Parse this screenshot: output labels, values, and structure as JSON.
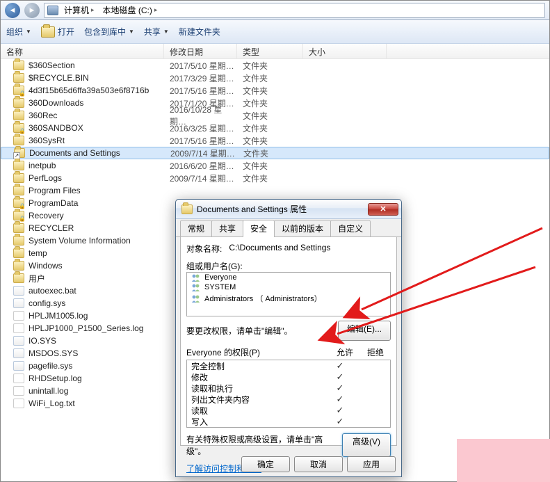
{
  "breadcrumb": {
    "root": "计算机",
    "drive": "本地磁盘 (C:)"
  },
  "toolbar": {
    "organize": "组织",
    "open": "打开",
    "include": "包含到库中",
    "share": "共享",
    "newfolder": "新建文件夹"
  },
  "columns": {
    "name": "名称",
    "date": "修改日期",
    "type": "类型",
    "size": "大小"
  },
  "type_folder": "文件夹",
  "files": [
    {
      "name": "$360Section",
      "date": "2017/5/10 星期…",
      "type": "文件夹",
      "ico": "folder"
    },
    {
      "name": "$RECYCLE.BIN",
      "date": "2017/3/29 星期…",
      "type": "文件夹",
      "ico": "folder"
    },
    {
      "name": "4d3f15b65d6ffa39a503e6f8716b",
      "date": "2017/5/16 星期…",
      "type": "文件夹",
      "ico": "folder lock"
    },
    {
      "name": "360Downloads",
      "date": "2017/1/20 星期…",
      "type": "文件夹",
      "ico": "folder"
    },
    {
      "name": "360Rec",
      "date": "2016/10/28 星期…",
      "type": "文件夹",
      "ico": "folder"
    },
    {
      "name": "360SANDBOX",
      "date": "2016/3/25 星期…",
      "type": "文件夹",
      "ico": "folder lock"
    },
    {
      "name": "360SysRt",
      "date": "2017/5/16 星期…",
      "type": "文件夹",
      "ico": "folder"
    },
    {
      "name": "Documents and Settings",
      "date": "2009/7/14 星期…",
      "type": "文件夹",
      "ico": "folder shortcut",
      "selected": true
    },
    {
      "name": "inetpub",
      "date": "2016/6/20 星期…",
      "type": "文件夹",
      "ico": "folder"
    },
    {
      "name": "PerfLogs",
      "date": "2009/7/14 星期…",
      "type": "文件夹",
      "ico": "folder"
    },
    {
      "name": "Program Files",
      "date": "",
      "type": "",
      "ico": "folder"
    },
    {
      "name": "ProgramData",
      "date": "",
      "type": "",
      "ico": "folder lock"
    },
    {
      "name": "Recovery",
      "date": "",
      "type": "",
      "ico": "folder lock"
    },
    {
      "name": "RECYCLER",
      "date": "",
      "type": "",
      "ico": "folder"
    },
    {
      "name": "System Volume Information",
      "date": "",
      "type": "",
      "ico": "folder"
    },
    {
      "name": "temp",
      "date": "",
      "type": "",
      "ico": "folder"
    },
    {
      "name": "Windows",
      "date": "",
      "type": "",
      "ico": "folder"
    },
    {
      "name": "用户",
      "date": "",
      "type": "",
      "ico": "folder"
    },
    {
      "name": "autoexec.bat",
      "date": "",
      "type": "",
      "ico": "file sys"
    },
    {
      "name": "config.sys",
      "date": "",
      "type": "",
      "ico": "file sys"
    },
    {
      "name": "HPLJM1005.log",
      "date": "",
      "type": "",
      "ico": "file txt"
    },
    {
      "name": "HPLJP1000_P1500_Series.log",
      "date": "",
      "type": "",
      "ico": "file txt"
    },
    {
      "name": "IO.SYS",
      "date": "",
      "type": "",
      "ico": "file sys"
    },
    {
      "name": "MSDOS.SYS",
      "date": "",
      "type": "",
      "ico": "file sys"
    },
    {
      "name": "pagefile.sys",
      "date": "",
      "type": "",
      "ico": "file sys"
    },
    {
      "name": "RHDSetup.log",
      "date": "",
      "type": "",
      "ico": "file txt"
    },
    {
      "name": "unintall.log",
      "date": "",
      "type": "",
      "ico": "file txt"
    },
    {
      "name": "WiFi_Log.txt",
      "date": "",
      "type": "",
      "ico": "file txt"
    }
  ],
  "dialog": {
    "title": "Documents and Settings 属性",
    "tabs": {
      "general": "常规",
      "share": "共享",
      "security": "安全",
      "prev": "以前的版本",
      "custom": "自定义"
    },
    "object_label": "对象名称:",
    "object_path": "C:\\Documents and Settings",
    "group_label": "组或用户名(G):",
    "principals": [
      "Everyone",
      "SYSTEM",
      "Administrators （                    Administrators）"
    ],
    "edit_hint": "要更改权限，请单击\"编辑\"。",
    "edit_btn": "编辑(E)...",
    "perm_label": "Everyone 的权限(P)",
    "allow": "允许",
    "deny": "拒绝",
    "perms": [
      {
        "n": "完全控制",
        "a": true
      },
      {
        "n": "修改",
        "a": true
      },
      {
        "n": "读取和执行",
        "a": true
      },
      {
        "n": "列出文件夹内容",
        "a": true
      },
      {
        "n": "读取",
        "a": true
      },
      {
        "n": "写入",
        "a": true
      }
    ],
    "adv_text": "有关特殊权限或高级设置，请单击\"高级\"。",
    "adv_btn": "高级(V)",
    "link": "了解访问控制和权限",
    "ok": "确定",
    "cancel": "取消",
    "apply": "应用"
  }
}
